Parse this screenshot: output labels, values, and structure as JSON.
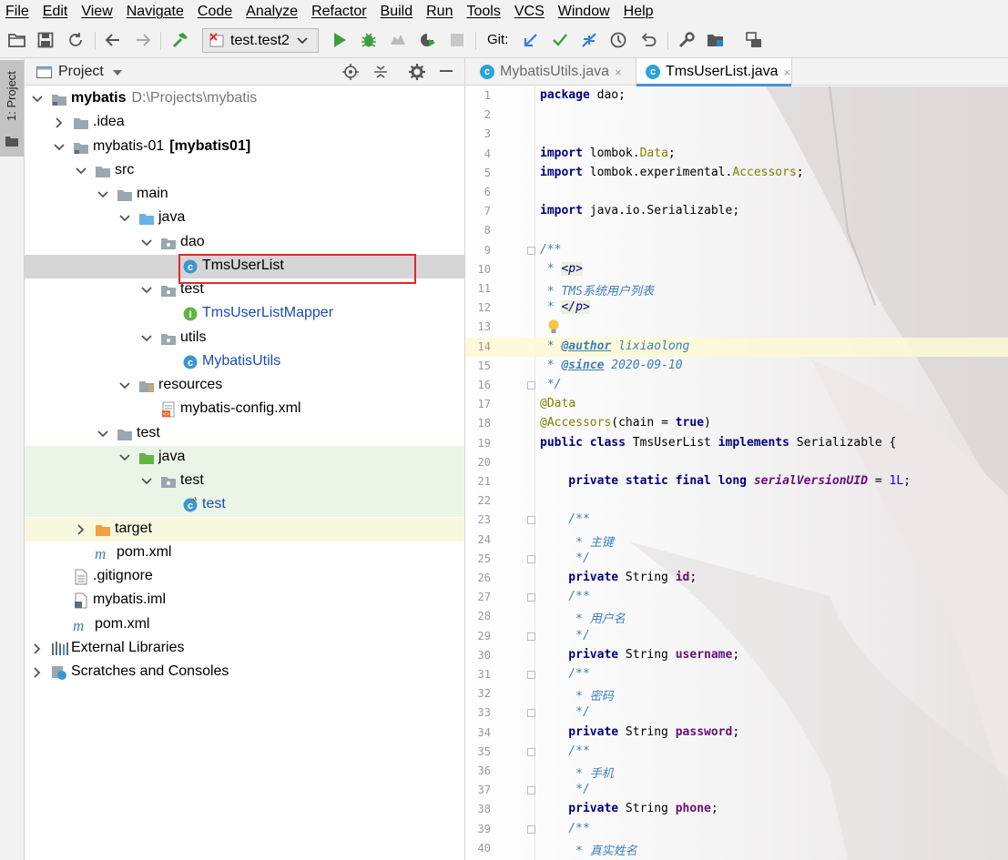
{
  "menu": [
    "File",
    "Edit",
    "View",
    "Navigate",
    "Code",
    "Analyze",
    "Refactor",
    "Build",
    "Run",
    "Tools",
    "VCS",
    "Window",
    "Help"
  ],
  "toolbar": {
    "run_config": "test.test2",
    "git_label": "Git:"
  },
  "side_stripe": {
    "label": "1: Project"
  },
  "project_panel": {
    "title": "Project"
  },
  "tree": [
    {
      "label": "mybatis",
      "extra": "D:\\Projects\\mybatis"
    },
    {
      "label": ".idea"
    },
    {
      "label": "mybatis-01",
      "extra": "[mybatis01]"
    },
    {
      "label": "src"
    },
    {
      "label": "main"
    },
    {
      "label": "java"
    },
    {
      "label": "dao"
    },
    {
      "label": "TmsUserList"
    },
    {
      "label": "test"
    },
    {
      "label": "TmsUserListMapper"
    },
    {
      "label": "utils"
    },
    {
      "label": "MybatisUtils"
    },
    {
      "label": "resources"
    },
    {
      "label": "mybatis-config.xml"
    },
    {
      "label": "test"
    },
    {
      "label": "java"
    },
    {
      "label": "test"
    },
    {
      "label": "test"
    },
    {
      "label": "target"
    },
    {
      "label": "pom.xml"
    },
    {
      "label": ".gitignore"
    },
    {
      "label": "mybatis.iml"
    },
    {
      "label": "pom.xml"
    },
    {
      "label": "External Libraries"
    },
    {
      "label": "Scratches and Consoles"
    }
  ],
  "tabs": [
    {
      "label": "MybatisUtils.java",
      "close": "×"
    },
    {
      "label": "TmsUserList.java",
      "close": "×"
    }
  ],
  "code": {
    "line_numbers": [
      "1",
      "2",
      "3",
      "4",
      "5",
      "6",
      "7",
      "8",
      "9",
      "10",
      "11",
      "12",
      "13",
      "14",
      "15",
      "16",
      "17",
      "18",
      "19",
      "20",
      "21",
      "22",
      "23",
      "24",
      "25",
      "26",
      "27",
      "28",
      "29",
      "30",
      "31",
      "32",
      "33",
      "34",
      "35",
      "36",
      "37",
      "38",
      "39",
      "40"
    ],
    "l1": [
      "package",
      " dao;"
    ],
    "l4": [
      "import",
      " lombok.",
      "Data",
      ";"
    ],
    "l5": [
      "import",
      " lombok.experimental.",
      "Accessors",
      ";"
    ],
    "l7": [
      "import",
      " java.io.Serializable;"
    ],
    "l9": "/**",
    "l10": [
      " * ",
      "<p>"
    ],
    "l11": " * TMS系统用户列表",
    "l12": [
      " * ",
      "</p>"
    ],
    "l14": [
      " * ",
      "@author",
      " lixiaolong"
    ],
    "l15": [
      " * ",
      "@since",
      " 2020-09-10"
    ],
    "l16": " */",
    "l17": "@Data",
    "l18": [
      "@Accessors",
      "(chain = ",
      "true",
      ")"
    ],
    "l19": [
      "public class",
      " TmsUserList ",
      "implements",
      " Serializable {"
    ],
    "l21": [
      "    private static final long",
      " ",
      "serialVersionUID",
      " = ",
      "1L",
      ";"
    ],
    "l23": "    /**",
    "l24": "     * 主键",
    "l25": "     */",
    "l26": [
      "    private",
      " String ",
      "id",
      ";"
    ],
    "l27": "    /**",
    "l28": "     * 用户名",
    "l29": "     */",
    "l30": [
      "    private",
      " String ",
      "username",
      ";"
    ],
    "l31": "    /**",
    "l32": "     * 密码",
    "l33": "     */",
    "l34": [
      "    private",
      " String ",
      "password",
      ";"
    ],
    "l35": "    /**",
    "l36": "     * 手机",
    "l37": "     */",
    "l38": [
      "    private",
      " String ",
      "phone",
      ";"
    ],
    "l39": "    /**",
    "l40": "     * 真实姓名"
  },
  "colors": {
    "accent": "#4a90d9",
    "highlight_box": "#e0282a",
    "run_green": "#3e9e3e"
  }
}
